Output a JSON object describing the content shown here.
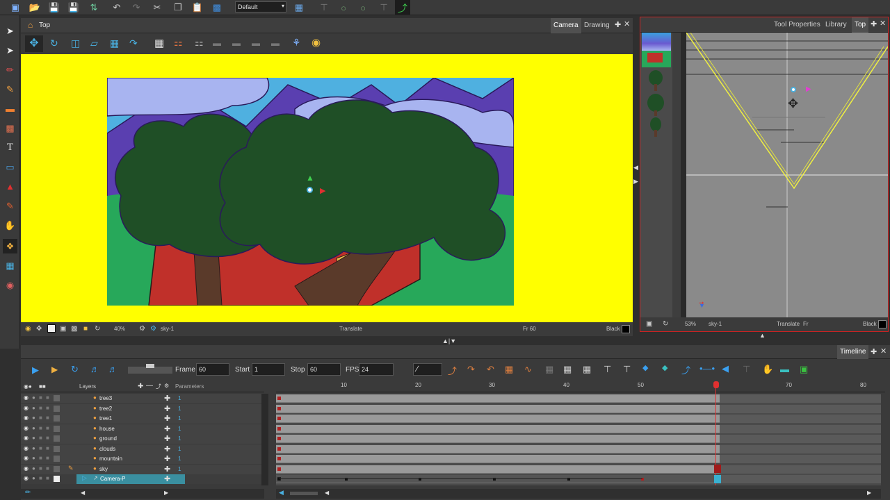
{
  "toolbar": {
    "workspace_select": "Default"
  },
  "camera_view": {
    "title": "Top",
    "tabs": [
      "Camera",
      "Drawing"
    ],
    "status": {
      "zoom": "40%",
      "layer": "sky-1",
      "mode": "Translate",
      "frame": "Fr 60",
      "color": "Black"
    },
    "stage_bg": "#ffff00"
  },
  "right_view": {
    "tabs": [
      "Tool Properties",
      "Library",
      "Top"
    ],
    "status": {
      "zoom": "53%",
      "layer": "sky-1",
      "mode": "Translate",
      "frame": "Fr",
      "color": "Black"
    }
  },
  "timeline": {
    "title": "Timeline",
    "frame_label": "Frame",
    "frame_value": "60",
    "start_label": "Start",
    "start_value": "1",
    "stop_label": "Stop",
    "stop_value": "60",
    "fps_label": "FPS",
    "fps_value": "24",
    "layers_header": "Layers",
    "params_header": "Parameters",
    "ruler": [
      "10",
      "20",
      "30",
      "40",
      "50",
      "70",
      "80"
    ],
    "layers": [
      {
        "name": "tree3",
        "value": "1"
      },
      {
        "name": "tree2",
        "value": "1"
      },
      {
        "name": "tree1",
        "value": "1"
      },
      {
        "name": "house",
        "value": "1"
      },
      {
        "name": "ground",
        "value": "1"
      },
      {
        "name": "clouds",
        "value": "1"
      },
      {
        "name": "mountain",
        "value": "1"
      },
      {
        "name": "sky",
        "value": "1"
      },
      {
        "name": "Camera-P",
        "value": ""
      }
    ]
  }
}
